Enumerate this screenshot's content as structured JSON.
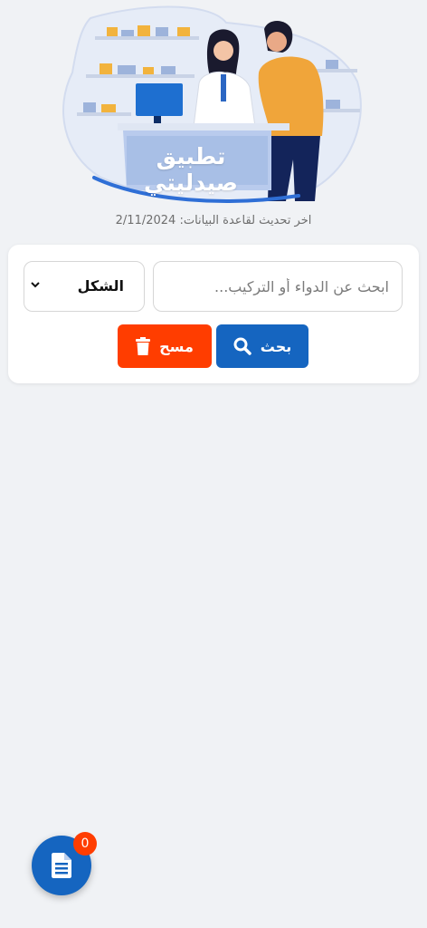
{
  "hero": {
    "title": "تطبيق صيدليتي",
    "illustration": "pharmacy-counter-illustration"
  },
  "database": {
    "updated_text": "اخر تحديث لقاعدة البيانات: 2/11/2024"
  },
  "search": {
    "placeholder": "ابحث عن الدواء أو التركيب...",
    "value": "",
    "form_select_value": "الشكل",
    "search_label": "بحث",
    "search_icon": "search-icon",
    "clear_label": "مسح",
    "clear_icon": "trash-icon"
  },
  "fab": {
    "icon": "document-icon",
    "badge_count": "0"
  },
  "colors": {
    "primary": "#1565c0",
    "danger": "#ff3d00",
    "background": "#f0f2f5"
  }
}
